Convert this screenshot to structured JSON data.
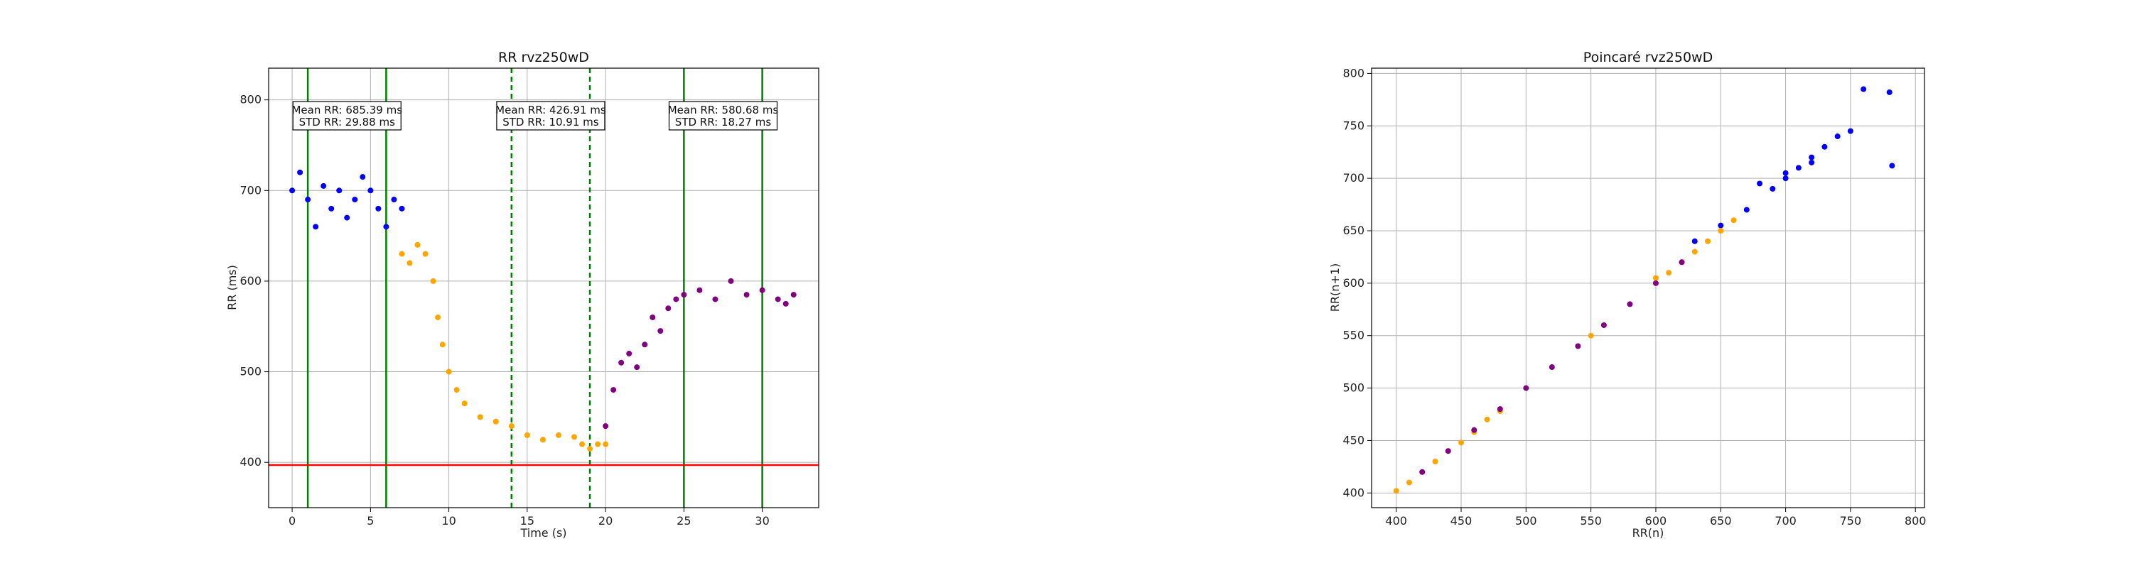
{
  "chart_data": [
    {
      "type": "scatter",
      "title": "RR rvz250wD",
      "xlabel": "Time (s)",
      "ylabel": "RR (ms)",
      "xlim": [
        -1.5,
        33.6
      ],
      "ylim": [
        350,
        835
      ],
      "xticks": [
        0,
        5,
        10,
        15,
        20,
        25,
        30
      ],
      "yticks": [
        400,
        500,
        600,
        700,
        800
      ],
      "grid": true,
      "series": [
        {
          "color": "#0000ff",
          "x": [
            0.0,
            0.5,
            1.0,
            1.5,
            2.0,
            2.5,
            3.0,
            3.5,
            4.0,
            4.5,
            5.0,
            5.5,
            6.0,
            6.5,
            7.0
          ],
          "y": [
            700,
            720,
            690,
            660,
            705,
            680,
            700,
            670,
            690,
            715,
            700,
            680,
            660,
            690,
            680
          ]
        },
        {
          "color": "#ffa500",
          "x": [
            7.0,
            7.5,
            8.0,
            8.5,
            9.0,
            9.3,
            9.6,
            10.0,
            10.5,
            11.0,
            12.0,
            13.0,
            14.0,
            15.0,
            16.0,
            17.0,
            18.0,
            18.5,
            19.0,
            19.5,
            20.0
          ],
          "y": [
            630,
            620,
            640,
            630,
            600,
            560,
            530,
            500,
            480,
            465,
            450,
            445,
            440,
            430,
            425,
            430,
            428,
            420,
            415,
            420,
            420
          ]
        },
        {
          "color": "#800080",
          "x": [
            20.0,
            20.5,
            21.0,
            21.5,
            22.0,
            22.5,
            23.0,
            23.5,
            24.0,
            24.5,
            25.0,
            26.0,
            27.0,
            28.0,
            29.0,
            30.0,
            31.0,
            31.5,
            32.0
          ],
          "y": [
            440,
            480,
            510,
            520,
            505,
            530,
            560,
            545,
            570,
            580,
            585,
            590,
            580,
            600,
            585,
            590,
            580,
            575,
            585
          ]
        }
      ],
      "hlines": [
        {
          "y": 397,
          "color": "#ff0000"
        }
      ],
      "vlines": [
        {
          "x": 1,
          "color": "#008000",
          "style": "solid"
        },
        {
          "x": 6,
          "color": "#008000",
          "style": "solid"
        },
        {
          "x": 14,
          "color": "#008000",
          "style": "dashed"
        },
        {
          "x": 19,
          "color": "#008000",
          "style": "dashed"
        },
        {
          "x": 25,
          "color": "#008000",
          "style": "solid"
        },
        {
          "x": 30,
          "color": "#008000",
          "style": "solid"
        }
      ],
      "annotations": [
        {
          "x": 3.5,
          "line1": "Mean RR: 685.39 ms",
          "line2": "STD RR: 29.88 ms"
        },
        {
          "x": 16.5,
          "line1": "Mean RR: 426.91 ms",
          "line2": "STD RR: 10.91 ms"
        },
        {
          "x": 27.5,
          "line1": "Mean RR: 580.68 ms",
          "line2": "STD RR: 18.27 ms"
        }
      ]
    },
    {
      "type": "scatter",
      "title": "Poincaré rvz250wD",
      "xlabel": "RR(n)",
      "ylabel": "RR(n+1)",
      "xlim": [
        381,
        807
      ],
      "ylim": [
        386,
        805
      ],
      "xticks": [
        400,
        450,
        500,
        550,
        600,
        650,
        700,
        750,
        800
      ],
      "yticks": [
        400,
        450,
        500,
        550,
        600,
        650,
        700,
        750,
        800
      ],
      "grid": true,
      "series": [
        {
          "color": "#0000ff",
          "x": [
            630,
            650,
            670,
            690,
            700,
            710,
            720,
            730,
            740,
            750,
            760,
            780,
            782,
            680,
            700,
            720
          ],
          "y": [
            640,
            655,
            670,
            690,
            700,
            710,
            715,
            730,
            740,
            745,
            785,
            782,
            712,
            695,
            705,
            720
          ]
        },
        {
          "color": "#ffa500",
          "x": [
            400,
            410,
            420,
            430,
            440,
            450,
            460,
            470,
            480,
            550,
            600,
            610,
            620,
            630,
            640,
            650,
            660
          ],
          "y": [
            402,
            410,
            420,
            430,
            440,
            448,
            458,
            470,
            478,
            550,
            605,
            610,
            620,
            630,
            640,
            650,
            660
          ]
        },
        {
          "color": "#800080",
          "x": [
            420,
            440,
            460,
            480,
            500,
            520,
            540,
            560,
            580,
            600,
            620
          ],
          "y": [
            420,
            440,
            460,
            480,
            500,
            520,
            540,
            560,
            580,
            600,
            620
          ]
        }
      ]
    }
  ]
}
